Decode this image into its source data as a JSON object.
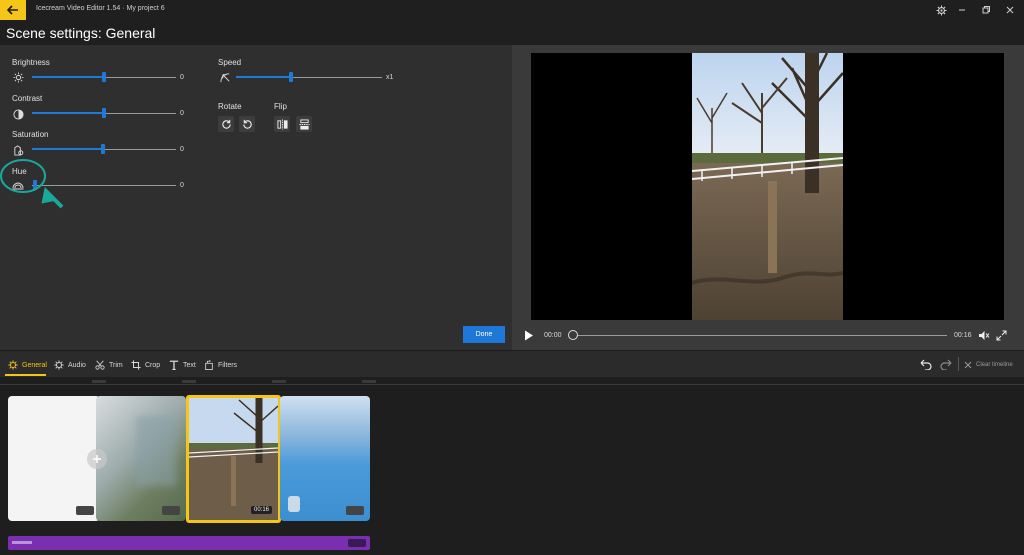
{
  "titlebar": {
    "title": "Icecream Video Editor 1.54 · My project 6"
  },
  "header": {
    "title": "Scene settings: General"
  },
  "adjustments": {
    "brightness": {
      "label": "Brightness",
      "value": "0"
    },
    "contrast": {
      "label": "Contrast",
      "value": "0"
    },
    "saturation": {
      "label": "Saturation",
      "value": "0"
    },
    "hue": {
      "label": "Hue",
      "value": "0"
    }
  },
  "speed": {
    "label": "Speed",
    "value": "x1"
  },
  "rotate": {
    "label": "Rotate"
  },
  "flip": {
    "label": "Flip"
  },
  "done_label": "Done",
  "player": {
    "current_time": "00:00",
    "duration": "00:16"
  },
  "tabs": [
    {
      "label": "General",
      "icon": "gear-icon"
    },
    {
      "label": "Audio",
      "icon": "audio-gear-icon"
    },
    {
      "label": "Trim",
      "icon": "scissors-icon"
    },
    {
      "label": "Crop",
      "icon": "crop-icon"
    },
    {
      "label": "Text",
      "icon": "text-icon"
    },
    {
      "label": "Filters",
      "icon": "filters-icon"
    }
  ],
  "toolbar": {
    "clear_timeline": "Clear timeline"
  },
  "clips": [
    {
      "duration": ""
    },
    {
      "duration": ""
    },
    {
      "duration": "00:16"
    },
    {
      "duration": ""
    }
  ],
  "colors": {
    "accent": "#f5c518",
    "primary": "#1e78d7",
    "audio": "#7a2fb0",
    "highlight": "#19a89a"
  }
}
